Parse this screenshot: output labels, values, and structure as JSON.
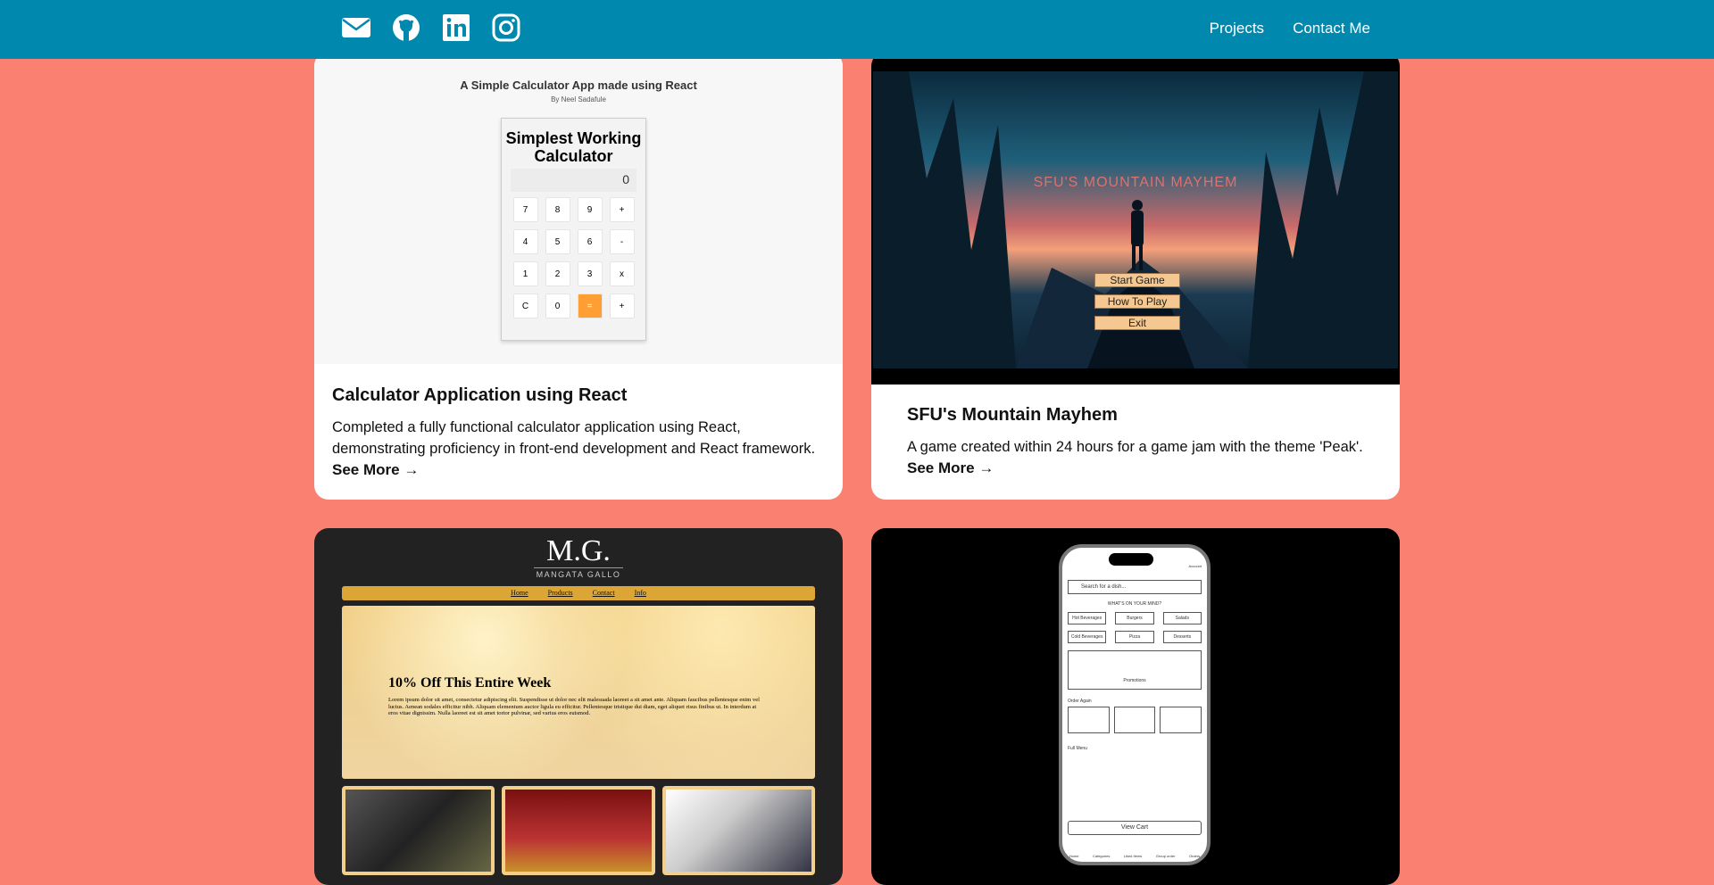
{
  "nav": {
    "icons": [
      "envelope-icon",
      "github-icon",
      "linkedin-icon",
      "instagram-icon"
    ],
    "links": [
      "Projects",
      "Contact Me"
    ]
  },
  "colors": {
    "nav": "#0088ae",
    "background": "#fa8072",
    "accent": "#ff9e33"
  },
  "cards": [
    {
      "title": "Calculator Application using React",
      "description": "Completed a fully functional calculator application using React, demonstrating proficiency in front-end development and React framework.",
      "link": "See More",
      "preview": {
        "heading": "A Simple Calculator App made using React",
        "byline": "By Neel Sadafule",
        "calc_title": "Simplest Working Calculator",
        "display": "0",
        "keys": [
          "7",
          "8",
          "9",
          "+",
          "4",
          "5",
          "6",
          "-",
          "1",
          "2",
          "3",
          "x",
          "C",
          "0",
          "=",
          "+"
        ]
      }
    },
    {
      "title": "SFU's Mountain Mayhem",
      "description": "A game created within 24 hours for a game jam with the theme 'Peak'.",
      "link": "See More",
      "preview": {
        "game_title": "SFU'S MOUNTAIN MAYHEM",
        "buttons": [
          "Start Game",
          "How To Play",
          "Exit"
        ]
      }
    },
    {
      "preview": {
        "logo": "M.G.",
        "brand": "MANGATA GALLO",
        "menu": [
          "Home",
          "Products",
          "Contact",
          "Info"
        ],
        "hero_title": "10% Off This Entire Week",
        "hero_text": "Lorem ipsum dolor sit amet, consectetur adipiscing elit. Suspendisse ut dolor nec elit malesuada laoreet a sit amet ante. Aliquam faucibus pellentesque enim vel luctus. Aenean sodales efficitur nibh. Aliquam elementum auctor ligula eu efficitur. Pellentesque tristique dui diam, eget aliquet risus finibus ut. In interdum at eros vitae dignissim. Nulla laoreet est sit amet tortor pulvinar, sed varius eros euismod."
      }
    },
    {
      "preview": {
        "account": "Account",
        "search": "Search for a dish...",
        "section": "WHAT'S ON YOUR MIND?",
        "categories": [
          "Hot Beverages",
          "Burgers",
          "Salads",
          "Cold Beverages",
          "Pizza",
          "Desserts"
        ],
        "promo": "Promotions",
        "order_again": "Order Again",
        "full_menu": "Full Menu",
        "view_cart": "View Cart",
        "tabs": [
          "Home",
          "Categories",
          "Liked Items",
          "Group order",
          "Orders"
        ]
      }
    }
  ]
}
